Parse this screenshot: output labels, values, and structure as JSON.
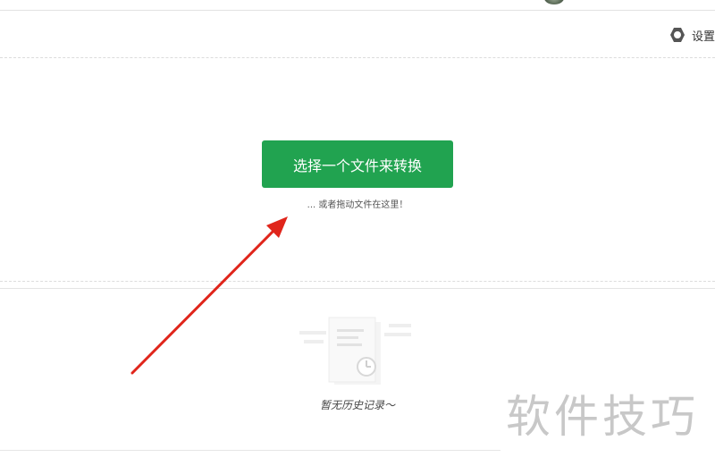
{
  "settings": {
    "label": "设置",
    "icon": "gear-icon"
  },
  "upload": {
    "button_label": "选择一个文件来转换",
    "hint": "... 或者拖动文件在这里！"
  },
  "history": {
    "empty_text": "暂无历史记录～",
    "icon": "document-clock-icon"
  },
  "watermark": "软件技巧",
  "colors": {
    "primary": "#21a350",
    "arrow": "#e0251b"
  }
}
